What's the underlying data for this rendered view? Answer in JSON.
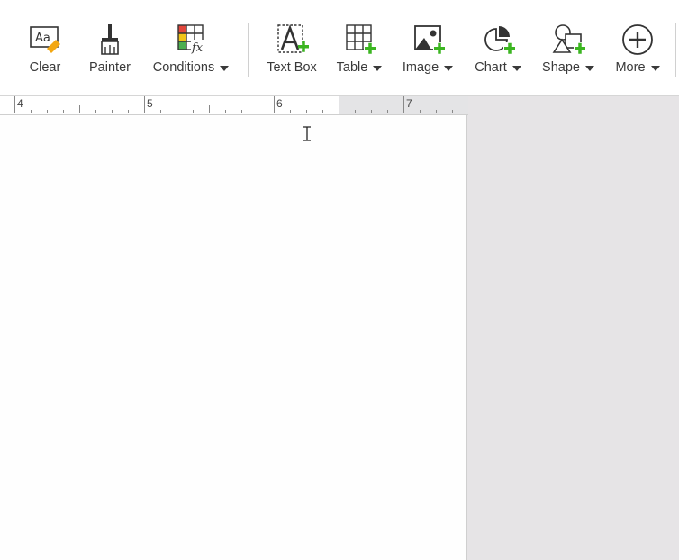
{
  "toolbar": {
    "buttons": [
      {
        "id": "clear",
        "label": "Clear",
        "icon": "clear-format-icon",
        "has_menu": false
      },
      {
        "id": "painter",
        "label": "Painter",
        "icon": "format-painter-icon",
        "has_menu": false
      },
      {
        "id": "conditions",
        "label": "Conditions",
        "icon": "conditional-format-icon",
        "has_menu": true
      },
      {
        "id": "textbox",
        "label": "Text Box",
        "icon": "text-box-icon",
        "has_menu": false
      },
      {
        "id": "table",
        "label": "Table",
        "icon": "table-icon",
        "has_menu": true
      },
      {
        "id": "image",
        "label": "Image",
        "icon": "image-icon",
        "has_menu": true
      },
      {
        "id": "chart",
        "label": "Chart",
        "icon": "chart-icon",
        "has_menu": true
      },
      {
        "id": "shape",
        "label": "Shape",
        "icon": "shape-icon",
        "has_menu": true
      },
      {
        "id": "more",
        "label": "More",
        "icon": "plus-circle-icon",
        "has_menu": true
      }
    ],
    "icon_text": {
      "clear": "Aa",
      "conditions": "fx"
    }
  },
  "ruler": {
    "labels": [
      "4",
      "5",
      "6",
      "7"
    ]
  },
  "colors": {
    "accent_green": "#3cb521",
    "eraser_orange": "#f3a712",
    "cond_red": "#e2463c",
    "cond_yellow": "#f0c419",
    "cond_green": "#4caf50"
  }
}
